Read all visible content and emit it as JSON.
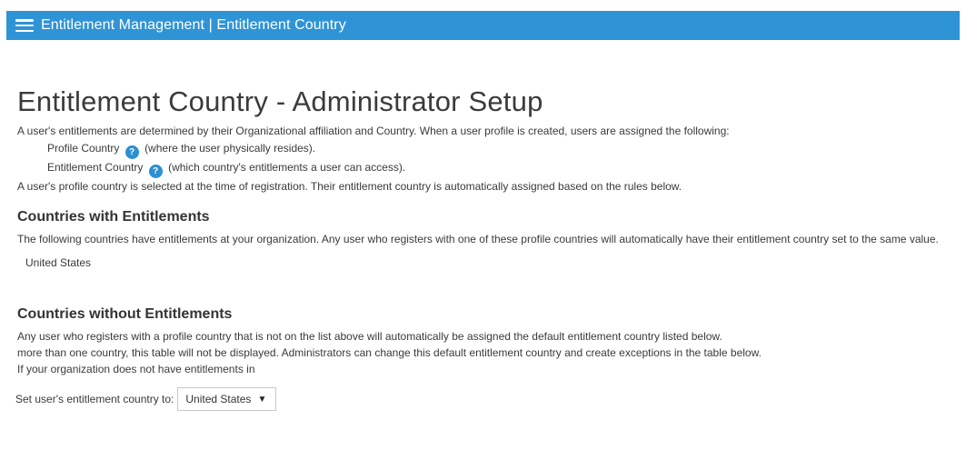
{
  "header": {
    "title": "Entitlement Management | Entitlement Country",
    "menu_icon": "hamburger-menu-icon"
  },
  "page": {
    "title": "Entitlement Country - Administrator Setup",
    "intro": "A user's entitlements are determined by their Organizational affiliation and Country. When a user profile is created, users are assigned the following:",
    "profile_country_label": "Profile Country",
    "profile_country_desc": "(where the user physically resides).",
    "entitlement_country_label": "Entitlement Country",
    "entitlement_country_desc": "(which country's entitlements a user can access).",
    "help_icon_glyph": "?",
    "profile_note": "A user's profile country is selected at the time of registration. Their entitlement country is automatically assigned based on the rules below."
  },
  "with_entitlements": {
    "heading": "Countries with Entitlements",
    "description": "The following countries have entitlements at your organization. Any user who registers with one of these profile countries will automatically have their entitlement country set to the same value.",
    "countries": [
      "United States"
    ]
  },
  "without_entitlements": {
    "heading": "Countries without Entitlements",
    "line1": "Any user who registers with a profile country that is not on the list above will automatically be assigned the default entitlement country listed below.",
    "line2": "more than one country, this table will not be displayed. Administrators can change this default entitlement country and create exceptions in the table below.",
    "line3": "If your organization does not have entitlements in",
    "select_label": "Set user's entitlement country to:",
    "select_value": "United States",
    "select_arrow": "▼"
  },
  "colors": {
    "header_bg": "#2f94d6",
    "help_icon_bg": "#2d8fd4"
  }
}
